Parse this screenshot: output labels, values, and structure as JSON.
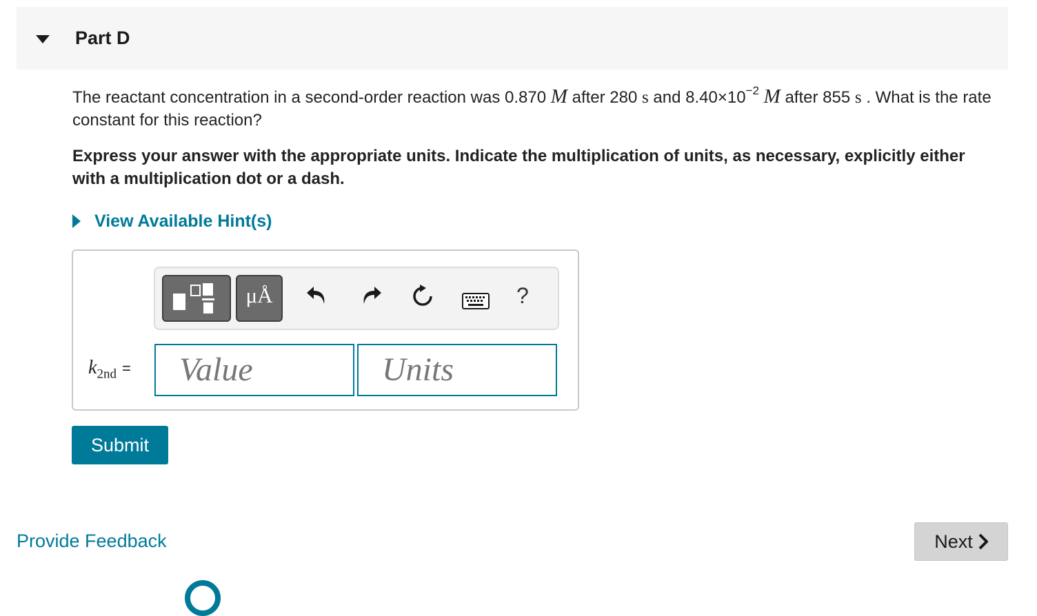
{
  "part": {
    "title": "Part D"
  },
  "question": {
    "text_1": "The reactant concentration in a second-order reaction was 0.870 ",
    "unit_M": "M",
    "text_2": " after 280 ",
    "unit_s": "s",
    "text_3": " and 8.40×10",
    "exponent": "−2",
    "text_4": " after 855 ",
    "text_5": " . What is the rate constant for this reaction?"
  },
  "instruction": "Express your answer with the appropriate units. Indicate the multiplication of units, as necessary, explicitly either with a multiplication dot or a dash.",
  "hint": {
    "label": "View Available Hint(s)"
  },
  "toolbar": {
    "units_label": "μÅ",
    "help_label": "?",
    "icons": [
      "templates-icon",
      "undo-icon",
      "redo-icon",
      "reset-icon",
      "keyboard-icon",
      "help-icon"
    ]
  },
  "answer": {
    "variable": "k",
    "subscript": "2nd",
    "equals": "=",
    "value_placeholder": "Value",
    "units_placeholder": "Units"
  },
  "buttons": {
    "submit": "Submit",
    "next": "Next",
    "feedback": "Provide Feedback"
  },
  "colors": {
    "accent": "#007a99",
    "header_bg": "#f6f6f6",
    "toolbar_btn": "#6b6b6b",
    "next_bg": "#d4d4d4"
  }
}
